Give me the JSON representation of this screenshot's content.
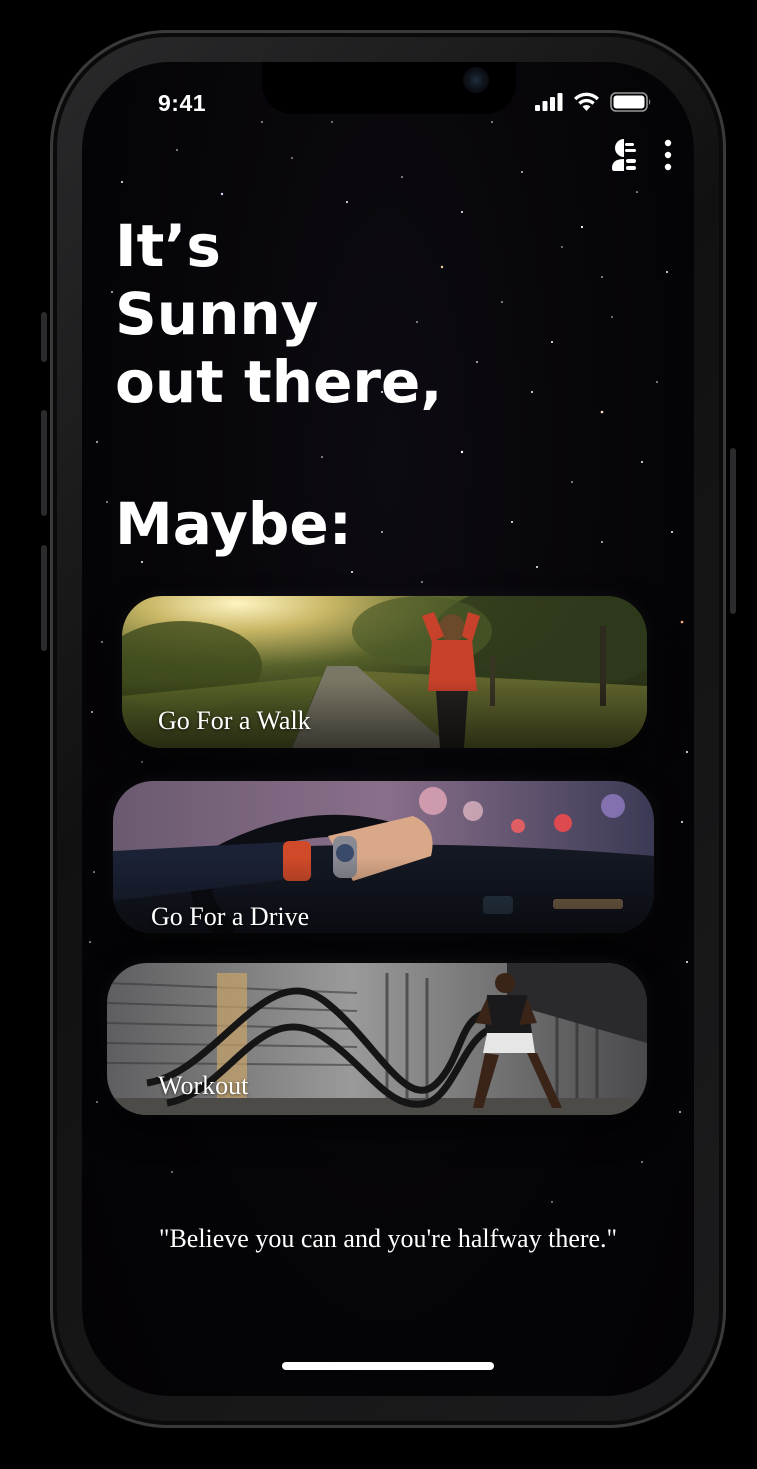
{
  "status_bar": {
    "time": "9:41",
    "icons": [
      "cellular-signal-icon",
      "wifi-icon",
      "battery-icon"
    ]
  },
  "top_bar": {
    "icons": [
      "profile-menu-icon",
      "more-vertical-icon"
    ]
  },
  "headline": {
    "line1": "It’s",
    "line2": "Sunny",
    "line3": "out there,",
    "subheading": "Maybe:"
  },
  "suggestions": [
    {
      "label": "Go For a Walk",
      "image": "person-walking-on-country-road"
    },
    {
      "label": "Go For a Drive",
      "image": "hand-on-steering-wheel"
    },
    {
      "label": "Workout",
      "image": "man-with-battle-ropes"
    }
  ],
  "quote": "\"Believe you can and you're halfway there.\"",
  "colors": {
    "background": "#050407",
    "text": "#ffffff"
  }
}
